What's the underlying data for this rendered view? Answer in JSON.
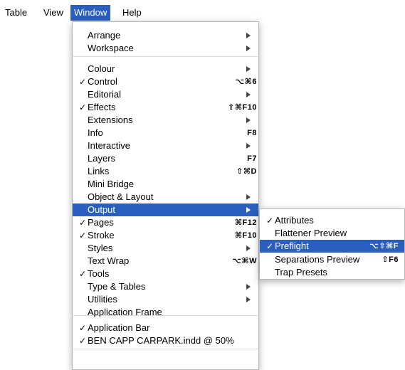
{
  "menubar": {
    "items": [
      "Table",
      "View",
      "Window",
      "Help"
    ],
    "active": "Window"
  },
  "window_menu": {
    "items": [
      {
        "label": "Arrange",
        "checked": false,
        "shortcut": "",
        "submenu": true
      },
      {
        "label": "Workspace",
        "checked": false,
        "shortcut": "",
        "submenu": true
      },
      {
        "label": "Colour",
        "checked": false,
        "shortcut": "",
        "submenu": true
      },
      {
        "label": "Control",
        "checked": true,
        "shortcut": "⌥⌘6",
        "submenu": false
      },
      {
        "label": "Editorial",
        "checked": false,
        "shortcut": "",
        "submenu": true
      },
      {
        "label": "Effects",
        "checked": true,
        "shortcut": "⇧⌘F10",
        "submenu": false
      },
      {
        "label": "Extensions",
        "checked": false,
        "shortcut": "",
        "submenu": true
      },
      {
        "label": "Info",
        "checked": false,
        "shortcut": "F8",
        "submenu": false
      },
      {
        "label": "Interactive",
        "checked": false,
        "shortcut": "",
        "submenu": true
      },
      {
        "label": "Layers",
        "checked": false,
        "shortcut": "F7",
        "submenu": false
      },
      {
        "label": "Links",
        "checked": false,
        "shortcut": "⇧⌘D",
        "submenu": false
      },
      {
        "label": "Mini Bridge",
        "checked": false,
        "shortcut": "",
        "submenu": false
      },
      {
        "label": "Object & Layout",
        "checked": false,
        "shortcut": "",
        "submenu": true
      },
      {
        "label": "Output",
        "checked": false,
        "shortcut": "",
        "submenu": true,
        "highlighted": true
      },
      {
        "label": "Pages",
        "checked": true,
        "shortcut": "⌘F12",
        "submenu": false
      },
      {
        "label": "Stroke",
        "checked": true,
        "shortcut": "⌘F10",
        "submenu": false
      },
      {
        "label": "Styles",
        "checked": false,
        "shortcut": "",
        "submenu": true
      },
      {
        "label": "Text Wrap",
        "checked": false,
        "shortcut": "⌥⌘W",
        "submenu": false
      },
      {
        "label": "Tools",
        "checked": true,
        "shortcut": "",
        "submenu": false
      },
      {
        "label": "Type & Tables",
        "checked": false,
        "shortcut": "",
        "submenu": true
      },
      {
        "label": "Utilities",
        "checked": false,
        "shortcut": "",
        "submenu": true
      },
      {
        "label": "Application Frame",
        "checked": false,
        "shortcut": "",
        "submenu": false
      },
      {
        "label": "Application Bar",
        "checked": true,
        "shortcut": "",
        "submenu": false
      },
      {
        "label": "BEN CAPP CARPARK.indd @ 50%",
        "checked": true,
        "shortcut": "",
        "submenu": false
      }
    ]
  },
  "output_submenu": {
    "items": [
      {
        "label": "Attributes",
        "checked": true,
        "shortcut": ""
      },
      {
        "label": "Flattener Preview",
        "checked": false,
        "shortcut": ""
      },
      {
        "label": "Preflight",
        "checked": true,
        "shortcut": "⌥⇧⌘F",
        "highlighted": true
      },
      {
        "label": "Separations Preview",
        "checked": false,
        "shortcut": "⇧F6"
      },
      {
        "label": "Trap Presets",
        "checked": false,
        "shortcut": ""
      }
    ]
  },
  "colors": {
    "highlight": "#2a5fc0",
    "highlight_text": "#ffffff"
  }
}
